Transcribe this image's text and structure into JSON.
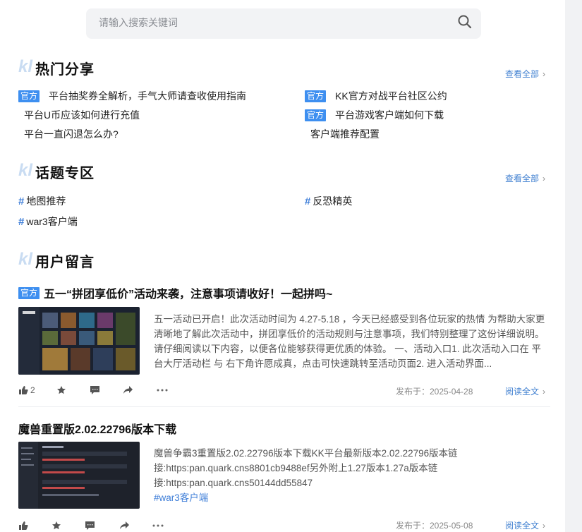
{
  "search": {
    "placeholder": "请输入搜索关键词"
  },
  "sections": {
    "hot": {
      "title": "热门分享",
      "view_all": "查看全部"
    },
    "topics": {
      "title": "话题专区",
      "view_all": "查看全部"
    },
    "messages": {
      "title": "用户留言"
    }
  },
  "hot_items": [
    {
      "tag": "官方",
      "text": "平台抽奖券全解析，手气大师请查收使用指南"
    },
    {
      "tag": "官方",
      "text": "KK官方对战平台社区公约"
    },
    {
      "tag": "",
      "text": "平台U币应该如何进行充值"
    },
    {
      "tag": "官方",
      "text": "平台游戏客户端如何下载"
    },
    {
      "tag": "",
      "text": "平台一直闪退怎么办?"
    },
    {
      "tag": "",
      "text": "客户端推荐配置"
    }
  ],
  "topics": [
    "地图推荐",
    "反恐精英",
    "war3客户端"
  ],
  "posts": [
    {
      "tag": "官方",
      "title": "五一“拼团享低价”活动来袭，注意事项请收好！一起拼吗~",
      "excerpt": "五一活动已开启！此次活动时间为 4.27-5.18 ，今天已经感受到各位玩家的热情 为帮助大家更清晰地了解此次活动中，拼团享低价的活动规则与注意事项，我们特别整理了这份详细说明。请仔细阅读以下内容，以便各位能够获得更优质的体验。 一、活动入口1. 此次活动入口在 平台大厅活动栏 与 右下角许愿成真，点击可快速跳转至活动页面2. 进入活动界面...",
      "excerpt_tag": "",
      "likes": "2",
      "date": "发布于：2025-04-28",
      "read_more": "阅读全文"
    },
    {
      "tag": "",
      "title": "魔兽重置版2.02.22796版本下载",
      "excerpt": "魔兽争霸3重置版2.02.22796版本下载KK平台最新版本2.02.22796版本链接:https:pan.quark.cns8801cb9488ef另外附上1.27版本1.27a版本链接:https:pan.quark.cns50144dd55847",
      "excerpt_tag": "#war3客户端",
      "likes": "",
      "date": "发布于：2025-05-08",
      "read_more": "阅读全文"
    }
  ],
  "colors": {
    "accent": "#3e8ff0",
    "link": "#3f7fd0",
    "hash": "#3e7ed8"
  },
  "icons": [
    "search-icon",
    "thumbs-up-icon",
    "star-icon",
    "comment-icon",
    "share-icon",
    "more-icon",
    "chevron-right-icon"
  ]
}
